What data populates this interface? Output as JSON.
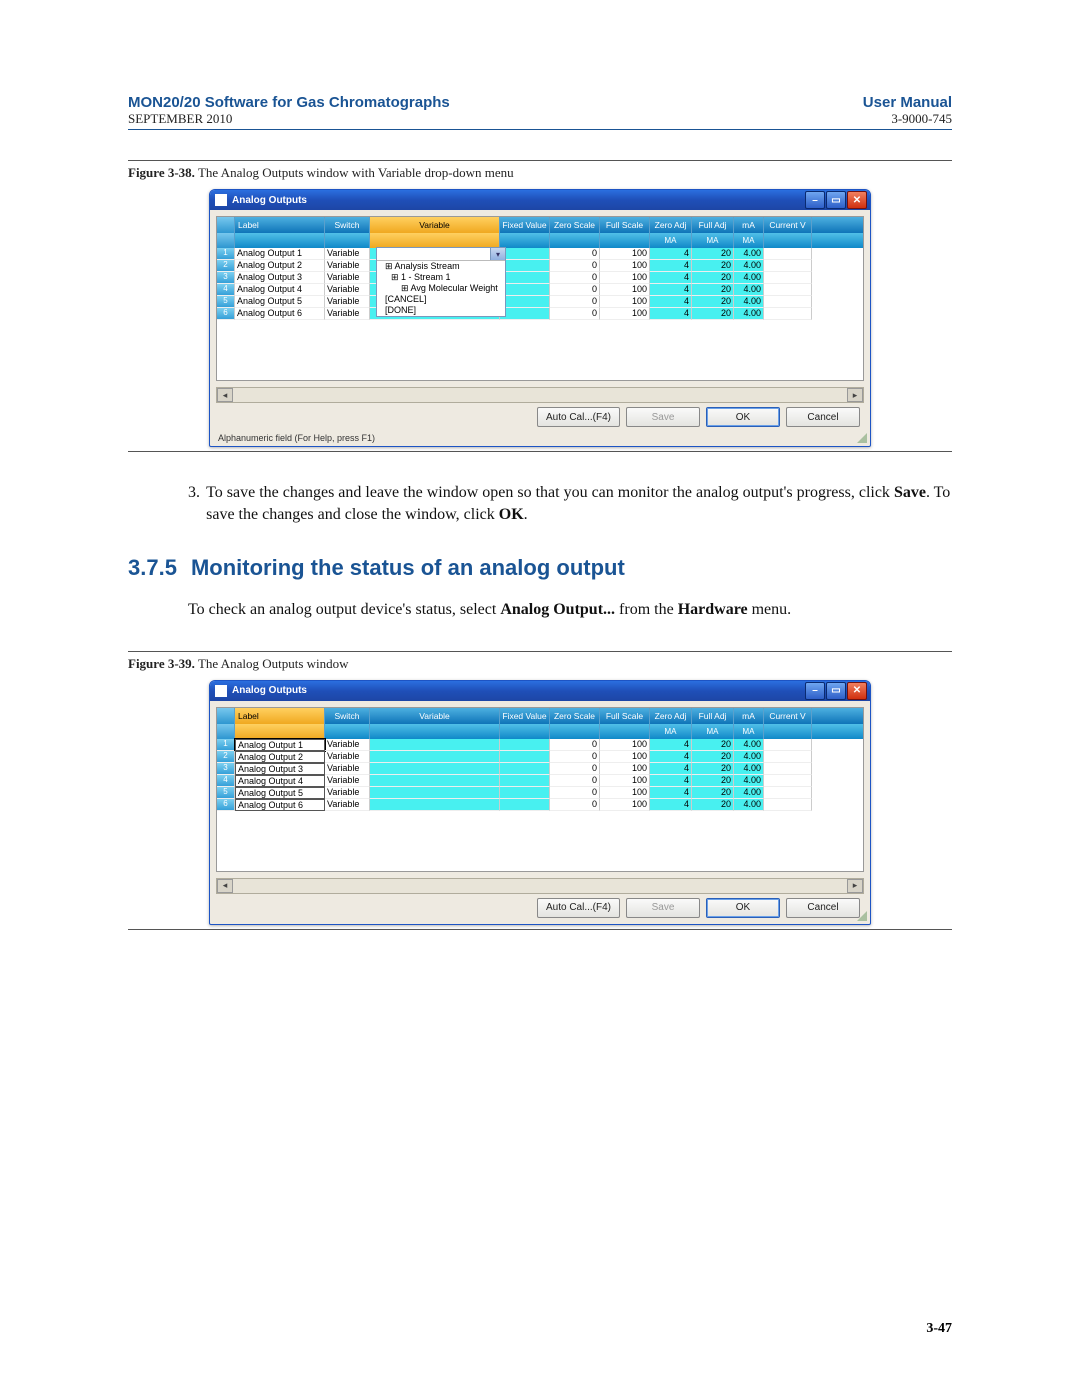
{
  "header": {
    "title_left": "MON20/20 Software for Gas Chromatographs",
    "sub_left": "SEPTEMBER 2010",
    "title_right": "User Manual",
    "sub_right": "3-9000-745"
  },
  "fig1": {
    "caption_label": "Figure 3-38.",
    "caption_text": "The Analog Outputs window with Variable drop-down menu",
    "window_title": "Analog Outputs",
    "status": "Alphanumeric field (For Help, press F1)",
    "columns": [
      "Label",
      "Switch",
      "Variable",
      "Fixed Value",
      "Zero Scale",
      "Full Scale",
      "Zero Adj",
      "Full Adj",
      "mA",
      "Current V"
    ],
    "sub_ma": "MA",
    "selected_col": "Variable",
    "dropdown": {
      "options": [
        {
          "text": "",
          "indent": 0,
          "sel": true
        },
        {
          "text": "Analysis Stream",
          "indent": 0,
          "tree": true
        },
        {
          "text": "1 - Stream 1",
          "indent": 1,
          "tree": true
        },
        {
          "text": "Avg Molecular Weight",
          "indent": 2,
          "tree": true
        },
        {
          "text": "[CANCEL]",
          "indent": 0
        },
        {
          "text": "[DONE]",
          "indent": 0
        }
      ]
    },
    "rows": [
      {
        "n": 1,
        "label": "Analog Output 1",
        "switch": "Variable",
        "var": "",
        "fval": "",
        "zscale": "0",
        "fscale": "100",
        "zadj": "4",
        "fadj": "20",
        "ma": "4.00",
        "curr": ""
      },
      {
        "n": 2,
        "label": "Analog Output 2",
        "switch": "Variable",
        "var": "",
        "fval": "",
        "zscale": "0",
        "fscale": "100",
        "zadj": "4",
        "fadj": "20",
        "ma": "4.00",
        "curr": ""
      },
      {
        "n": 3,
        "label": "Analog Output 3",
        "switch": "Variable",
        "var": "",
        "fval": "",
        "zscale": "0",
        "fscale": "100",
        "zadj": "4",
        "fadj": "20",
        "ma": "4.00",
        "curr": ""
      },
      {
        "n": 4,
        "label": "Analog Output 4",
        "switch": "Variable",
        "var": "",
        "fval": "",
        "zscale": "0",
        "fscale": "100",
        "zadj": "4",
        "fadj": "20",
        "ma": "4.00",
        "curr": ""
      },
      {
        "n": 5,
        "label": "Analog Output 5",
        "switch": "Variable",
        "var": "",
        "fval": "",
        "zscale": "0",
        "fscale": "100",
        "zadj": "4",
        "fadj": "20",
        "ma": "4.00",
        "curr": ""
      },
      {
        "n": 6,
        "label": "Analog Output 6",
        "switch": "Variable",
        "var": "",
        "fval": "",
        "zscale": "0",
        "fscale": "100",
        "zadj": "4",
        "fadj": "20",
        "ma": "4.00",
        "curr": ""
      }
    ],
    "buttons": {
      "autocal": "Auto Cal...(F4)",
      "save": "Save",
      "ok": "OK",
      "cancel": "Cancel"
    }
  },
  "para1": {
    "num": "3.",
    "text_a": "To save the changes and leave the window open so that you can monitor the analog output's progress, click ",
    "b1": "Save",
    "text_b": ". To save the changes and close the window, click ",
    "b2": "OK",
    "text_c": "."
  },
  "heading": {
    "num": "3.7.5",
    "text": "Monitoring the status of an analog output"
  },
  "para2": {
    "text_a": "To check an analog output device's status, select ",
    "b1": "Analog Output...",
    "text_b": " from the ",
    "b2": "Hardware",
    "text_c": " menu."
  },
  "fig2": {
    "caption_label": "Figure 3-39.",
    "caption_text": "The Analog Outputs window",
    "window_title": "Analog Outputs",
    "selected_col": "Label",
    "columns": [
      "Label",
      "Switch",
      "Variable",
      "Fixed Value",
      "Zero Scale",
      "Full Scale",
      "Zero Adj",
      "Full Adj",
      "mA",
      "Current V"
    ],
    "sub_ma": "MA",
    "rows": [
      {
        "n": 1,
        "label": "Analog Output 1",
        "switch": "Variable",
        "var": "",
        "fval": "",
        "zscale": "0",
        "fscale": "100",
        "zadj": "4",
        "fadj": "20",
        "ma": "4.00",
        "curr": ""
      },
      {
        "n": 2,
        "label": "Analog Output 2",
        "switch": "Variable",
        "var": "",
        "fval": "",
        "zscale": "0",
        "fscale": "100",
        "zadj": "4",
        "fadj": "20",
        "ma": "4.00",
        "curr": ""
      },
      {
        "n": 3,
        "label": "Analog Output 3",
        "switch": "Variable",
        "var": "",
        "fval": "",
        "zscale": "0",
        "fscale": "100",
        "zadj": "4",
        "fadj": "20",
        "ma": "4.00",
        "curr": ""
      },
      {
        "n": 4,
        "label": "Analog Output 4",
        "switch": "Variable",
        "var": "",
        "fval": "",
        "zscale": "0",
        "fscale": "100",
        "zadj": "4",
        "fadj": "20",
        "ma": "4.00",
        "curr": ""
      },
      {
        "n": 5,
        "label": "Analog Output 5",
        "switch": "Variable",
        "var": "",
        "fval": "",
        "zscale": "0",
        "fscale": "100",
        "zadj": "4",
        "fadj": "20",
        "ma": "4.00",
        "curr": ""
      },
      {
        "n": 6,
        "label": "Analog Output 6",
        "switch": "Variable",
        "var": "",
        "fval": "",
        "zscale": "0",
        "fscale": "100",
        "zadj": "4",
        "fadj": "20",
        "ma": "4.00",
        "curr": ""
      }
    ],
    "buttons": {
      "autocal": "Auto Cal...(F4)",
      "save": "Save",
      "ok": "OK",
      "cancel": "Cancel"
    }
  },
  "page_number": "3-47"
}
